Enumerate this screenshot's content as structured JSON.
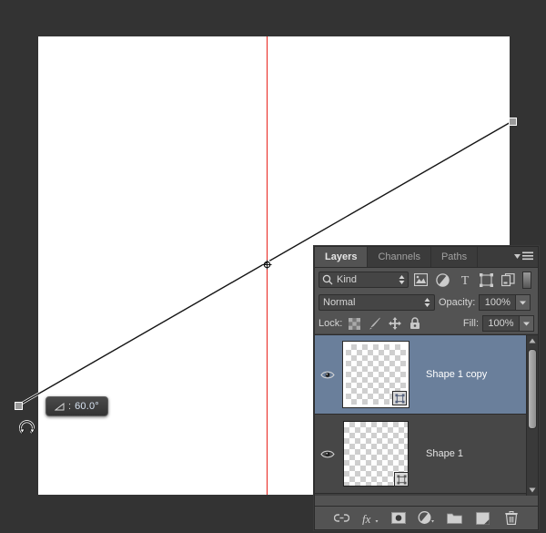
{
  "canvas": {
    "guide_color": "#e8221c",
    "background": "#ffffff",
    "workspace_color": "#333333"
  },
  "transform": {
    "tooltip": {
      "icon": "angle-icon",
      "label": ":",
      "value": "60.0°"
    },
    "handles": [
      "top-right-handle",
      "bottom-left-handle"
    ],
    "reference_point": "center-reference-point",
    "cursor": "rotate-cursor"
  },
  "panel": {
    "tabs": [
      {
        "label": "Layers",
        "active": true
      },
      {
        "label": "Channels",
        "active": false
      },
      {
        "label": "Paths",
        "active": false
      }
    ],
    "menu_icon": "panel-menu-icon",
    "filter": {
      "search_icon": "search-icon",
      "kind_label": "Kind",
      "stepper_icon": "stepper-arrows-icon",
      "type_icons": [
        "pixel-layer-filter-icon",
        "adjustment-layer-filter-icon",
        "type-layer-filter-icon",
        "shape-layer-filter-icon",
        "smart-object-filter-icon"
      ],
      "toggle_icon": "filter-enable-toggle"
    },
    "blend": {
      "mode": "Normal",
      "stepper_icon": "stepper-arrows-icon",
      "opacity_label": "Opacity:",
      "opacity_value": "100%",
      "opacity_arrow": "chevron-down-icon"
    },
    "lock": {
      "label": "Lock:",
      "icons": [
        "lock-transparency-icon",
        "lock-image-pixels-icon",
        "lock-position-icon",
        "lock-all-icon"
      ],
      "fill_label": "Fill:",
      "fill_value": "100%",
      "fill_arrow": "chevron-down-icon"
    },
    "layers": [
      {
        "name": "Shape 1 copy",
        "selected": true,
        "visible": true,
        "eye_icon": "eye-icon",
        "thumbnail": "transparent-checkerboard",
        "badge_icon": "vector-mask-icon"
      },
      {
        "name": "Shape 1",
        "selected": false,
        "visible": true,
        "eye_icon": "eye-icon",
        "thumbnail": "transparent-checkerboard",
        "badge_icon": "vector-mask-icon"
      }
    ],
    "scrollbar": {
      "up_icon": "scroll-up-arrow-icon",
      "down_icon": "scroll-down-arrow-icon",
      "thumb": "scrollbar-thumb"
    },
    "bottom_buttons": [
      "link-layers-icon",
      "layer-style-fx-icon",
      "add-layer-mask-icon",
      "new-adjustment-layer-icon",
      "new-group-icon",
      "new-layer-icon",
      "delete-layer-icon"
    ]
  },
  "colors": {
    "selection_blue": "#6a7f9b",
    "panel_gray": "#535353",
    "list_gray": "#474747",
    "guide_red": "#e8221c"
  }
}
